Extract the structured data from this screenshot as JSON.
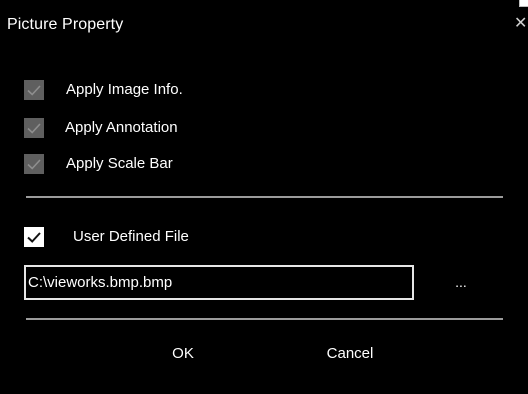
{
  "window": {
    "title": "Picture Property",
    "close_glyph": "✕"
  },
  "options": [
    {
      "label": "Apply Image Info.",
      "checked": true,
      "enabled": false
    },
    {
      "label": "Apply Annotation",
      "checked": true,
      "enabled": false
    },
    {
      "label": "Apply Scale Bar",
      "checked": true,
      "enabled": false
    }
  ],
  "user_defined": {
    "label": "User Defined File",
    "checked": true,
    "enabled": true
  },
  "file_path": {
    "value": "C:\\vieworks.bmp.bmp"
  },
  "browse": {
    "label": "..."
  },
  "buttons": {
    "ok": "OK",
    "cancel": "Cancel"
  },
  "icons": {
    "close": "close-icon",
    "checkbox": "checkmark-icon"
  },
  "colors": {
    "background": "#000000",
    "text": "#ffffff",
    "disabled_checkbox": "#5f5f5f",
    "enabled_checkbox": "#ffffff",
    "divider": "#9b9b9b"
  }
}
